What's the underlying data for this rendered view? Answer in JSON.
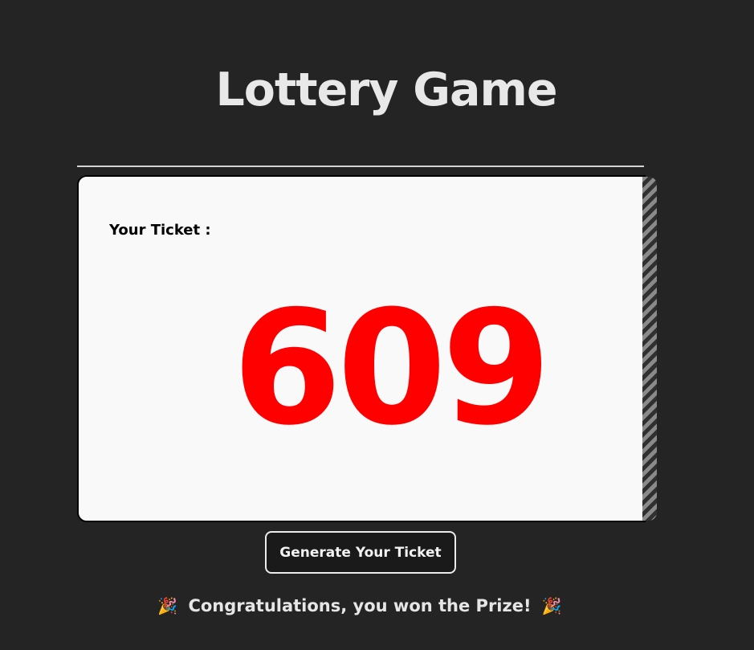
{
  "app": {
    "title": "Lottery Game"
  },
  "ticket": {
    "label": "Your Ticket :",
    "number": "609"
  },
  "actions": {
    "generate_label": "Generate Your Ticket"
  },
  "result": {
    "message": "Congratulations, you won the Prize!",
    "icon_left": "🎉",
    "icon_right": "🎉"
  },
  "colors": {
    "background": "#242424",
    "ticket_number": "#ff0000",
    "card": "#f9f9f9"
  }
}
